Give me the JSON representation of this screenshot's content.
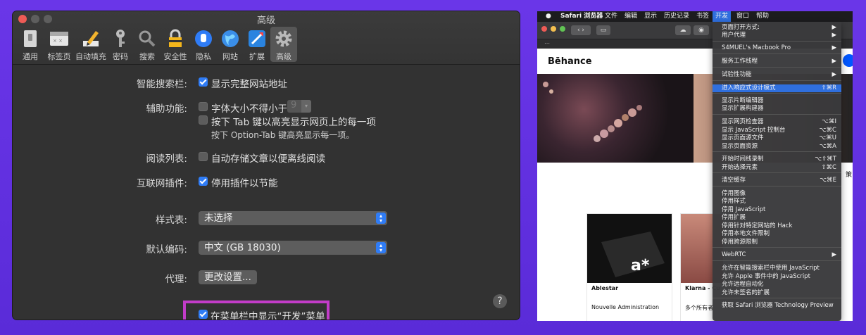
{
  "left": {
    "title": "高级",
    "tabs": [
      "通用",
      "标签页",
      "自动填充",
      "密码",
      "搜索",
      "安全性",
      "隐私",
      "网站",
      "扩展",
      "高级"
    ],
    "smart_search_label": "智能搜索栏:",
    "show_full_url": "显示完整网站地址",
    "accessibility_label": "辅助功能:",
    "min_font": "字体大小不得小于",
    "min_font_value": "9",
    "tab_highlight": "按下 Tab 键以高亮显示网页上的每一项",
    "tab_hint": "按下 Option-Tab 键高亮显示每一项。",
    "reading_label": "阅读列表:",
    "reading_text": "自动存储文章以便离线阅读",
    "plugins_label": "互联网插件:",
    "plugins_text": "停用插件以节能",
    "stylesheet_label": "样式表:",
    "stylesheet_value": "未选择",
    "encoding_label": "默认编码:",
    "encoding_value": "中文 (GB 18030)",
    "proxy_label": "代理:",
    "proxy_button": "更改设置...",
    "develop_menu": "在菜单栏中显示“开发”菜单",
    "help": "?"
  },
  "right": {
    "menubar": [
      "Safari 浏览器",
      "文件",
      "编辑",
      "显示",
      "历史记录",
      "书签",
      "开发",
      "窗口",
      "帮助"
    ],
    "behance": "Bēhance",
    "cards": [
      {
        "title": "Ablestar",
        "sub": "Nouvelle Administration"
      },
      {
        "title": "Klarna - Cu",
        "sub": "多个所有者"
      }
    ],
    "side_char": "策",
    "logo_text": "a*",
    "menu": [
      {
        "label": "页面打开方式:",
        "sc": "▶"
      },
      {
        "label": "用户代理",
        "sc": "▶"
      },
      {
        "label": "S4MUEL's Macbook Pro",
        "sc": "▶"
      },
      {
        "label": "服务工作线程",
        "sc": "▶"
      },
      {
        "label": "试验性功能",
        "sc": "▶"
      },
      {
        "label": "进入响应式设计模式",
        "sc": "⇧⌘R"
      },
      {
        "label": "显示片断编辑器",
        "sc": ""
      },
      {
        "label": "显示扩展构建器",
        "sc": ""
      },
      {
        "label": "显示网页检查器",
        "sc": "⌥⌘I"
      },
      {
        "label": "显示 JavaScript 控制台",
        "sc": "⌥⌘C"
      },
      {
        "label": "显示页面源文件",
        "sc": "⌥⌘U"
      },
      {
        "label": "显示页面资源",
        "sc": "⌥⌘A"
      },
      {
        "label": "开始时间线录制",
        "sc": "⌥⇧⌘T"
      },
      {
        "label": "开始选择元素",
        "sc": "⇧⌘C"
      },
      {
        "label": "清空缓存",
        "sc": "⌥⌘E"
      },
      {
        "label": "停用图像",
        "sc": ""
      },
      {
        "label": "停用样式",
        "sc": ""
      },
      {
        "label": "停用 JavaScript",
        "sc": ""
      },
      {
        "label": "停用扩展",
        "sc": ""
      },
      {
        "label": "停用针对特定网站的 Hack",
        "sc": ""
      },
      {
        "label": "停用本地文件限制",
        "sc": ""
      },
      {
        "label": "停用跨源限制",
        "sc": ""
      },
      {
        "label": "WebRTC",
        "sc": "▶"
      },
      {
        "label": "允许在智能搜索栏中使用 JavaScript",
        "sc": ""
      },
      {
        "label": "允许 Apple 事件中的 JavaScript",
        "sc": ""
      },
      {
        "label": "允许远程自动化",
        "sc": ""
      },
      {
        "label": "允许未签名的扩展",
        "sc": ""
      },
      {
        "label": "获取 Safari 浏览器 Technology Preview",
        "sc": ""
      }
    ]
  }
}
